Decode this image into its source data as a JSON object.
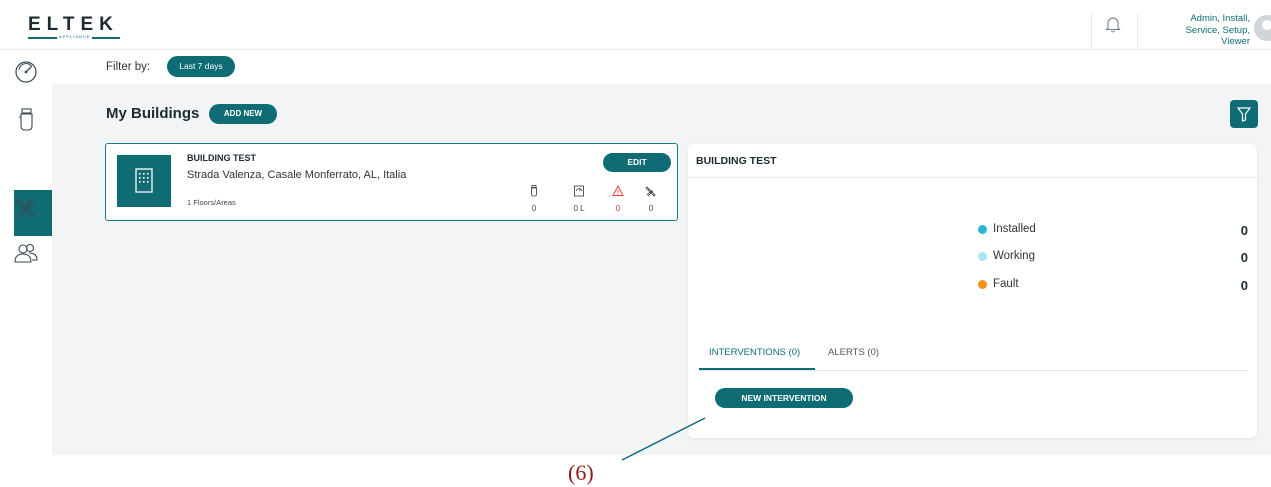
{
  "header": {
    "logo": "ELTEK",
    "logo_sub": "APPLIANCE",
    "user_roles": [
      "Admin, Install,",
      "Service, Setup,",
      "Viewer"
    ]
  },
  "sidebar": {
    "items": [
      {
        "icon": "gauge-icon"
      },
      {
        "icon": "device-icon"
      },
      {
        "icon": "building-icon",
        "active": true
      },
      {
        "icon": "tools-icon"
      },
      {
        "icon": "users-icon"
      }
    ]
  },
  "filter": {
    "label": "Filter by:",
    "value": "Last 7 days"
  },
  "buildings": {
    "title": "My Buildings",
    "add_new": "ADD NEW",
    "card": {
      "name": "BUILDING TEST",
      "address": "Strada Valenza, Casale Monferrato, AL, Italia",
      "floors": "1 Floors/Areas",
      "edit": "EDIT",
      "stats": [
        {
          "icon": "device-icon",
          "value": "0"
        },
        {
          "icon": "water-meter-icon",
          "value": "0 L"
        },
        {
          "icon": "warning-icon",
          "value": "0"
        },
        {
          "icon": "tools-icon",
          "value": "0"
        }
      ]
    }
  },
  "detail": {
    "title": "BUILDING TEST",
    "legend": [
      {
        "label": "Installed",
        "value": "0",
        "color": "#29b6d6"
      },
      {
        "label": "Working",
        "value": "0",
        "color": "#a5e6f2"
      },
      {
        "label": "Fault",
        "value": "0",
        "color": "#f5921e"
      }
    ],
    "tabs": [
      {
        "label": "INTERVENTIONS (0)",
        "active": true
      },
      {
        "label": "ALERTS (0)",
        "active": false
      }
    ],
    "new_intervention": "NEW INTERVENTION"
  },
  "annotation": {
    "label": "(6)"
  },
  "colors": {
    "accent": "#0f6c75",
    "alert": "#e53935",
    "background": "#f3f4f5"
  }
}
